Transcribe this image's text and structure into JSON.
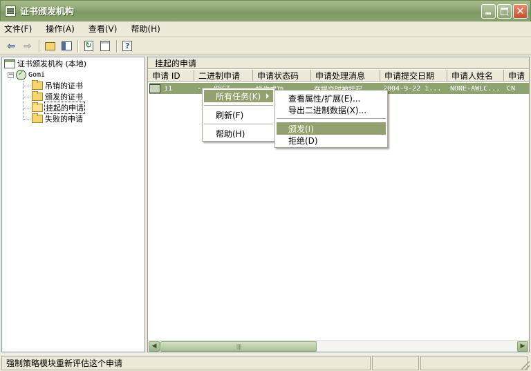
{
  "window": {
    "title": "证书颁发机构"
  },
  "menubar": {
    "items": [
      "文件(F)",
      "操作(A)",
      "查看(V)",
      "帮助(H)"
    ]
  },
  "toolbar": {
    "buttons": [
      "back-arrow-icon",
      "forward-arrow-icon",
      "folder-up-icon",
      "show-tree-icon",
      "refresh-icon",
      "export-list-icon",
      "help-icon"
    ]
  },
  "tree": {
    "root": "证书颁发机构 (本地)",
    "ca": "Gomi",
    "folders": [
      "吊销的证书",
      "颁发的证书",
      "挂起的申请",
      "失败的申请"
    ]
  },
  "main": {
    "title": "挂起的申请",
    "columns": [
      "申请 ID",
      "二进制申请",
      "申请状态码",
      "申请处理消息",
      "申请提交日期",
      "申请人姓名",
      "申请"
    ],
    "rows": [
      {
        "id": "11",
        "binary": "----BEGI...",
        "status_code": "操作成功",
        "message": "在提交时被挂起",
        "date": "2004-9-22 1...",
        "requester": "NONE-AWLC...",
        "extra": "CN"
      }
    ]
  },
  "context_menu": {
    "items": [
      "所有任务(K)",
      "刷新(F)",
      "帮助(H)"
    ]
  },
  "submenu": {
    "items": [
      "查看属性/扩展(E)...",
      "导出二进制数据(X)...",
      "颁发(I)",
      "拒绝(D)"
    ],
    "highlighted": "颁发(I)"
  },
  "statusbar": {
    "text": "强制策略模块重新评估这个申请"
  },
  "colors": {
    "title_bar": "#8FA876",
    "selection": "#8DA470",
    "menu_highlight": "#93A070"
  }
}
